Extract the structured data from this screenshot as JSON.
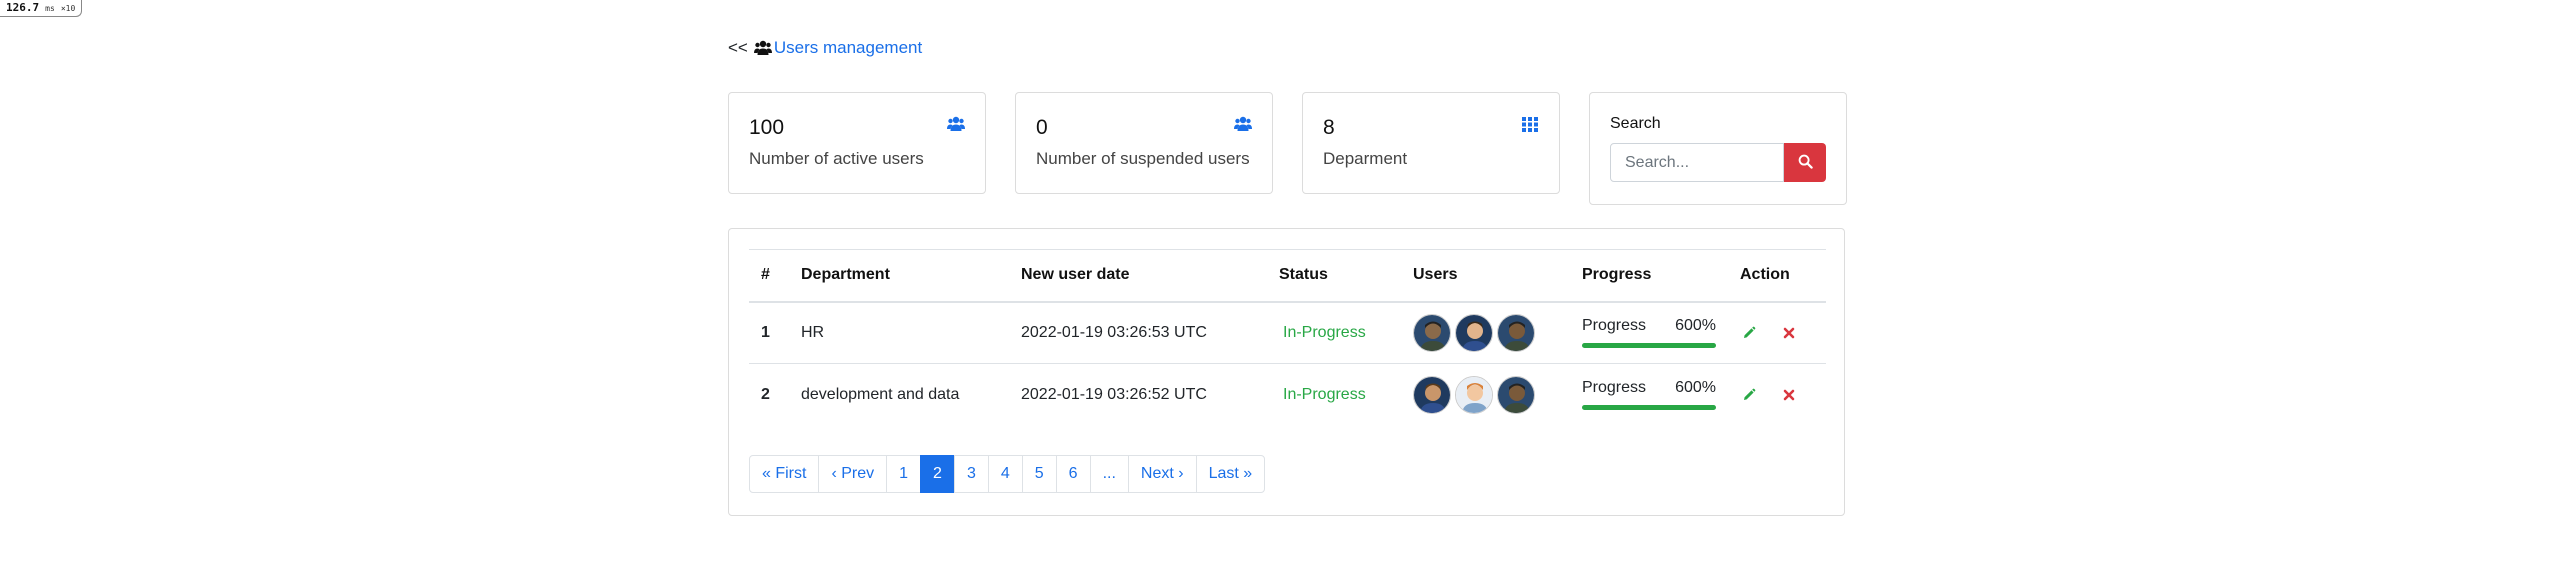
{
  "perf": {
    "value": "126.7",
    "unit": "ms",
    "suffix": "×10"
  },
  "breadcrumb": {
    "back": "<<",
    "icon": "users-icon",
    "link": "Users management"
  },
  "stats": [
    {
      "value": "100",
      "label": "Number of active users",
      "icon": "users-icon"
    },
    {
      "value": "0",
      "label": "Number of suspended users",
      "icon": "users-icon"
    },
    {
      "value": "8",
      "label": "Deparment",
      "icon": "grid-icon"
    }
  ],
  "search": {
    "label": "Search",
    "placeholder": "Search...",
    "button_icon": "search-icon"
  },
  "table": {
    "headers": [
      "#",
      "Department",
      "New user date",
      "Status",
      "Users",
      "Progress",
      "Action"
    ],
    "rows": [
      {
        "idx": "1",
        "department": "HR",
        "date": "2022-01-19 03:26:53 UTC",
        "status": "In-Progress",
        "progress_label": "Progress",
        "progress_value": "600%",
        "progress_fill": 1.0
      },
      {
        "idx": "2",
        "department": "development and data",
        "date": "2022-01-19 03:26:52 UTC",
        "status": "In-Progress",
        "progress_label": "Progress",
        "progress_value": "600%",
        "progress_fill": 1.0
      }
    ]
  },
  "pagination": [
    "« First",
    "‹ Prev",
    "1",
    "2",
    "3",
    "4",
    "5",
    "6",
    "...",
    "Next ›",
    "Last »"
  ],
  "pagination_active": "2",
  "colors": {
    "accent": "#1a6fe8",
    "success": "#28a745",
    "danger": "#d9363e"
  }
}
